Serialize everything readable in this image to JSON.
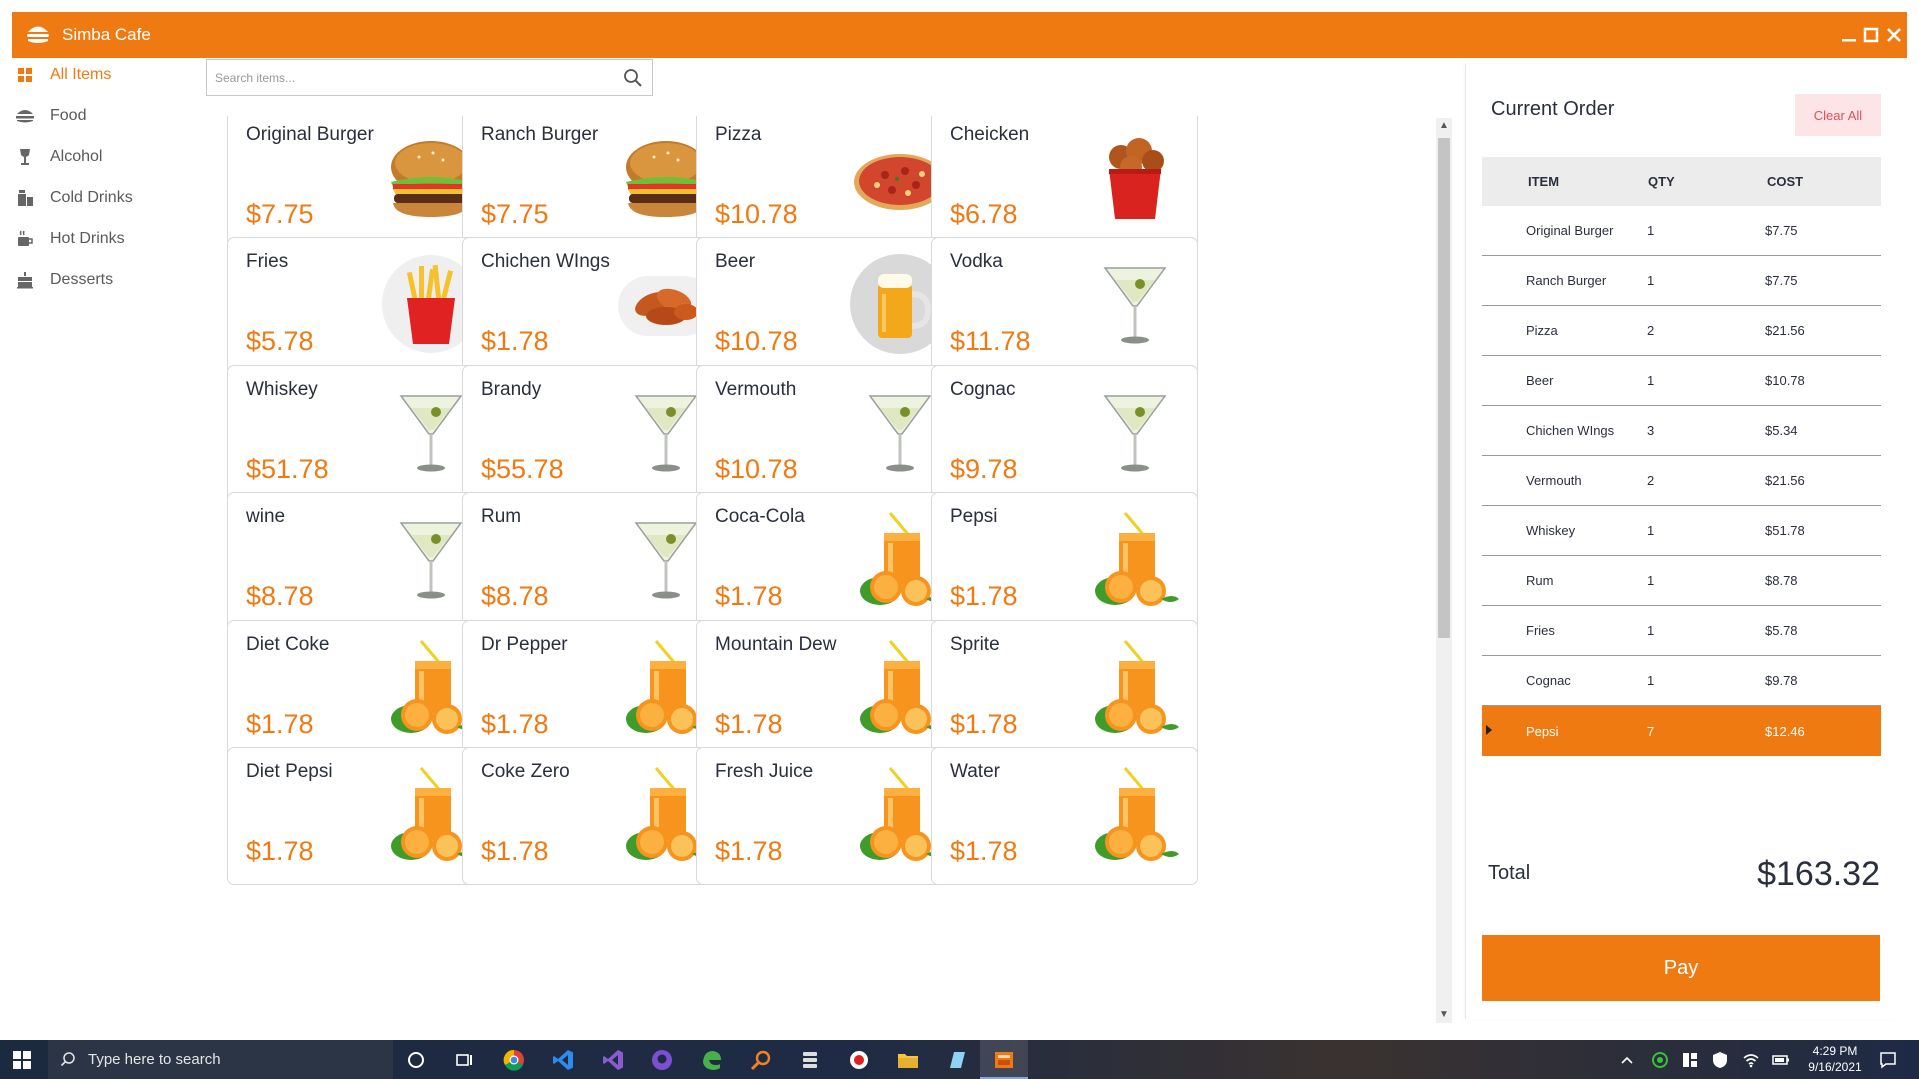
{
  "app": {
    "title": "Simba Cafe"
  },
  "sidebar": {
    "items": [
      {
        "label": "All Items",
        "icon": "grid-icon",
        "active": true
      },
      {
        "label": "Food",
        "icon": "burger-icon",
        "active": false
      },
      {
        "label": "Alcohol",
        "icon": "wine-glass-icon",
        "active": false
      },
      {
        "label": "Cold Drinks",
        "icon": "soda-icon",
        "active": false
      },
      {
        "label": "Hot Drinks",
        "icon": "coffee-cup-icon",
        "active": false
      },
      {
        "label": "Desserts",
        "icon": "cake-icon",
        "active": false
      }
    ]
  },
  "search": {
    "placeholder": "Search items..."
  },
  "products": [
    {
      "name": "Original Burger",
      "price": "$7.75",
      "image": "burger"
    },
    {
      "name": "Ranch Burger",
      "price": "$7.75",
      "image": "burger"
    },
    {
      "name": "Pizza",
      "price": "$10.78",
      "image": "pizza"
    },
    {
      "name": "Cheicken",
      "price": "$6.78",
      "image": "chicken-bucket"
    },
    {
      "name": "Fries",
      "price": "$5.78",
      "image": "fries"
    },
    {
      "name": "Chichen WIngs",
      "price": "$1.78",
      "image": "wings"
    },
    {
      "name": "Beer",
      "price": "$10.78",
      "image": "beer"
    },
    {
      "name": "Vodka",
      "price": "$11.78",
      "image": "martini"
    },
    {
      "name": "Whiskey",
      "price": "$51.78",
      "image": "martini"
    },
    {
      "name": "Brandy",
      "price": "$55.78",
      "image": "martini"
    },
    {
      "name": "Vermouth",
      "price": "$10.78",
      "image": "martini"
    },
    {
      "name": "Cognac",
      "price": "$9.78",
      "image": "martini"
    },
    {
      "name": "wine",
      "price": "$8.78",
      "image": "martini"
    },
    {
      "name": "Rum",
      "price": "$8.78",
      "image": "martini"
    },
    {
      "name": "Coca-Cola",
      "price": "$1.78",
      "image": "orange-juice"
    },
    {
      "name": "Pepsi",
      "price": "$1.78",
      "image": "orange-juice"
    },
    {
      "name": "Diet Coke",
      "price": "$1.78",
      "image": "orange-juice"
    },
    {
      "name": "Dr Pepper",
      "price": "$1.78",
      "image": "orange-juice"
    },
    {
      "name": "Mountain Dew",
      "price": "$1.78",
      "image": "orange-juice"
    },
    {
      "name": "Sprite",
      "price": "$1.78",
      "image": "orange-juice"
    },
    {
      "name": "Diet Pepsi",
      "price": "$1.78",
      "image": "orange-juice"
    },
    {
      "name": "Coke Zero",
      "price": "$1.78",
      "image": "orange-juice"
    },
    {
      "name": "Fresh Juice",
      "price": "$1.78",
      "image": "orange-juice"
    },
    {
      "name": "Water",
      "price": "$1.78",
      "image": "orange-juice"
    }
  ],
  "order": {
    "title": "Current Order",
    "clear_label": "Clear All",
    "columns": {
      "item": "ITEM",
      "qty": "QTY",
      "cost": "COST"
    },
    "rows": [
      {
        "item": "Original Burger",
        "qty": "1",
        "cost": "$7.75",
        "selected": false
      },
      {
        "item": "Ranch Burger",
        "qty": "1",
        "cost": "$7.75",
        "selected": false
      },
      {
        "item": "Pizza",
        "qty": "2",
        "cost": "$21.56",
        "selected": false
      },
      {
        "item": "Beer",
        "qty": "1",
        "cost": "$10.78",
        "selected": false
      },
      {
        "item": "Chichen WIngs",
        "qty": "3",
        "cost": "$5.34",
        "selected": false
      },
      {
        "item": "Vermouth",
        "qty": "2",
        "cost": "$21.56",
        "selected": false
      },
      {
        "item": "Whiskey",
        "qty": "1",
        "cost": "$51.78",
        "selected": false
      },
      {
        "item": "Rum",
        "qty": "1",
        "cost": "$8.78",
        "selected": false
      },
      {
        "item": "Fries",
        "qty": "1",
        "cost": "$5.78",
        "selected": false
      },
      {
        "item": "Cognac",
        "qty": "1",
        "cost": "$9.78",
        "selected": false
      },
      {
        "item": "Pepsi",
        "qty": "7",
        "cost": "$12.46",
        "selected": true
      }
    ],
    "total_label": "Total",
    "total_value": "$163.32",
    "pay_label": "Pay"
  },
  "taskbar": {
    "search_placeholder": "Type here to search",
    "time": "4:29 PM",
    "date": "9/16/2021"
  },
  "colors": {
    "accent": "#f07a12",
    "text": "#2a2f3d",
    "clear_bg": "#fde4e6",
    "clear_text": "#e0505a"
  }
}
